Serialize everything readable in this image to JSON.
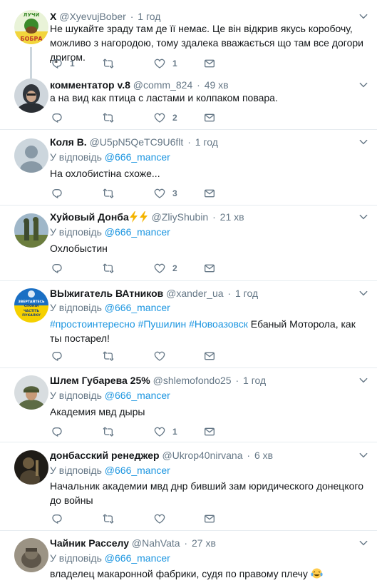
{
  "tweets": [
    {
      "name": "X",
      "handle": "@XyevujBober",
      "time": "1 год",
      "avatar_text": "ЛУЧИ БОБРА",
      "text": "Не шукайте зраду  там де її немає. Це він відкрив якусь коробочу, можливо з нагородою, тому здалека вважається що там все догори дригом.",
      "replies": "1",
      "retweets": "",
      "likes": "1"
    },
    {
      "name": "комментатор v.8",
      "handle": "@comm_824",
      "time": "49 хв",
      "text": "а на вид как птица с ластами и колпаком повара.",
      "replies": "",
      "retweets": "",
      "likes": "2"
    },
    {
      "name": "Коля В.",
      "handle": "@U5pN5QeTC9U6flt",
      "time": "1 год",
      "reply_prefix": "У відповідь",
      "reply_user": "@666_mancer",
      "text": "На охлобистіна схоже...",
      "replies": "",
      "retweets": "",
      "likes": "3"
    },
    {
      "name": "Хуйовый Донба",
      "handle": "@ZliyShubin",
      "time": "21 хв",
      "reply_prefix": "У відповідь",
      "reply_user": "@666_mancer",
      "text": "Охлобыстин",
      "replies": "",
      "retweets": "",
      "likes": "2"
    },
    {
      "name": "ВЫжигатель ВАтников",
      "handle": "@xander_ua",
      "time": "1 год",
      "avatar_text": "ЗВЕРТАЙТЕСЬ СПОКІЙ ЧАСТІТЬ ПУКАЛКУ",
      "reply_prefix": "У відповідь",
      "reply_user": "@666_mancer",
      "hashtags": [
        "#простоинтересно",
        "#Пушилин",
        "#Новоазовск"
      ],
      "text_rest": " Ебаный Моторола, как ты постарел!",
      "replies": "",
      "retweets": "",
      "likes": ""
    },
    {
      "name": "Шлем Губарева 25%",
      "handle": "@shlemofondo25",
      "time": "1 год",
      "reply_prefix": "У відповідь",
      "reply_user": "@666_mancer",
      "text": "Академия мвд дыры",
      "replies": "",
      "retweets": "",
      "likes": "1"
    },
    {
      "name": "донбасский ренеджер",
      "handle": "@Ukrop40nirvana",
      "time": "6 хв",
      "reply_prefix": "У відповідь",
      "reply_user": "@666_mancer",
      "text": "Начальник академии мвд днр бивший зам юридического донецкого до войны",
      "replies": "",
      "retweets": "",
      "likes": ""
    },
    {
      "name": "Чайник Расселу",
      "handle": "@NahVata",
      "time": "27 хв",
      "reply_prefix": "У відповідь",
      "reply_user": "@666_mancer",
      "text": "владелец макаронной фабрики, судя по правому плечу",
      "replies": "",
      "retweets": "",
      "likes": ""
    }
  ]
}
